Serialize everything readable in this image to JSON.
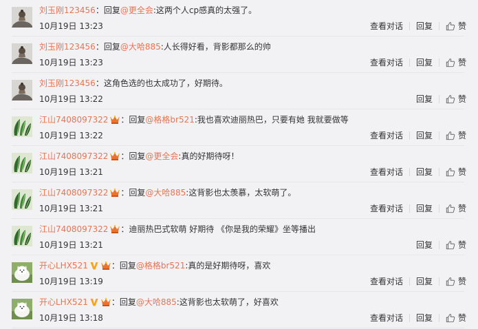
{
  "ui": {
    "reply_word": "回复",
    "view_conversation": "查看对话",
    "reply_action": "回复",
    "like_action": "赞"
  },
  "comments": [
    {
      "user": "刘玉刚123456",
      "avatar": "gray-ornament",
      "badges": [],
      "reply_to": "@更全会",
      "text": "这两个人cp感真的太强了。",
      "time": "10月19日 13:23",
      "show_conversation": true
    },
    {
      "user": "刘玉刚123456",
      "avatar": "gray-ornament",
      "badges": [],
      "reply_to": "@大哈885",
      "text": "人长得好看，背影都那么的帅",
      "time": "10月19日 13:23",
      "show_conversation": true
    },
    {
      "user": "刘玉刚123456",
      "avatar": "gray-ornament",
      "badges": [],
      "reply_to": "",
      "text": "这角色选的也太成功了，好期待。",
      "time": "10月19日 13:22",
      "show_conversation": false
    },
    {
      "user": "江山7408097322",
      "avatar": "green-leaves",
      "badges": [
        "vip"
      ],
      "reply_to": "@格格br521",
      "text": "我也喜欢迪丽热巴，只要有她 我就要做等",
      "time": "10月19日 13:22",
      "show_conversation": true
    },
    {
      "user": "江山7408097322",
      "avatar": "green-leaves",
      "badges": [
        "vip"
      ],
      "reply_to": "@更全会",
      "text": "真的好期待呀！",
      "time": "10月19日 13:21",
      "show_conversation": true
    },
    {
      "user": "江山7408097322",
      "avatar": "green-leaves",
      "badges": [
        "vip"
      ],
      "reply_to": "@大哈885",
      "text": "这背影也太羡慕，太软萌了。",
      "time": "10月19日 13:21",
      "show_conversation": true
    },
    {
      "user": "江山7408097322",
      "avatar": "green-leaves",
      "badges": [
        "vip"
      ],
      "reply_to": "",
      "text": "迪丽热巴式软萌  好期待 《你是我的荣耀》坐等播出",
      "time": "10月19日 13:21",
      "show_conversation": false
    },
    {
      "user": "开心LHX521",
      "avatar": "white-dog",
      "badges": [
        "verified",
        "vip"
      ],
      "reply_to": "@格格br521",
      "text": "真的是好期待呀，喜欢",
      "time": "10月19日 13:19",
      "show_conversation": true
    },
    {
      "user": "开心LHX521",
      "avatar": "white-dog",
      "badges": [
        "verified",
        "vip"
      ],
      "reply_to": "@大哈885",
      "text": "这背影也太软萌了，好喜欢",
      "time": "10月19日 13:18",
      "show_conversation": true
    }
  ],
  "colors": {
    "background": "#f2f2f5",
    "username": "#eb7350",
    "text": "#333333",
    "divider": "#e6e6e6",
    "verified": "#f7a41d",
    "vip": "#e8742f"
  }
}
